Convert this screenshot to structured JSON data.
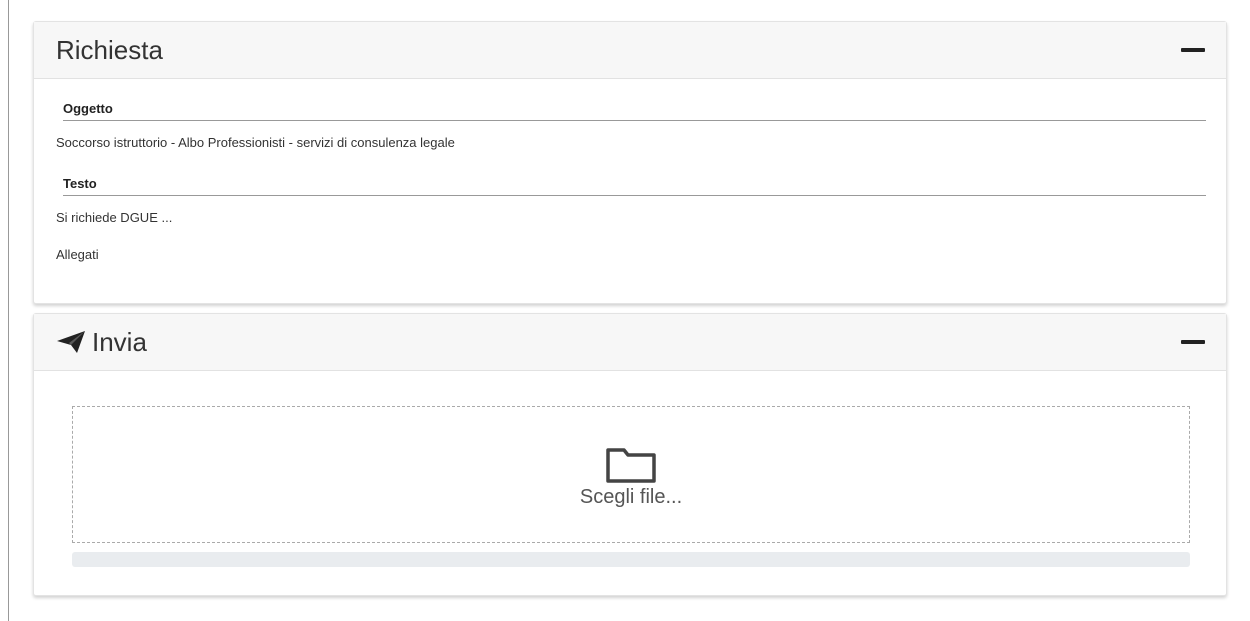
{
  "richiesta": {
    "title": "Richiesta",
    "oggetto_label": "Oggetto",
    "oggetto_value": "Soccorso istruttorio - Albo Professionisti - servizi di consulenza legale",
    "testo_label": "Testo",
    "testo_value": "Si richiede DGUE ...",
    "allegati_label": "Allegati"
  },
  "invia": {
    "title": "Invia",
    "icon": "paper-plane-icon",
    "dropzone_icon": "folder-icon",
    "dropzone_label": "Scegli file...",
    "upload_progress": 0
  },
  "colors": {
    "header_bg": "#f7f7f7",
    "progress_track": "#e9ecef",
    "text": "#333333"
  }
}
